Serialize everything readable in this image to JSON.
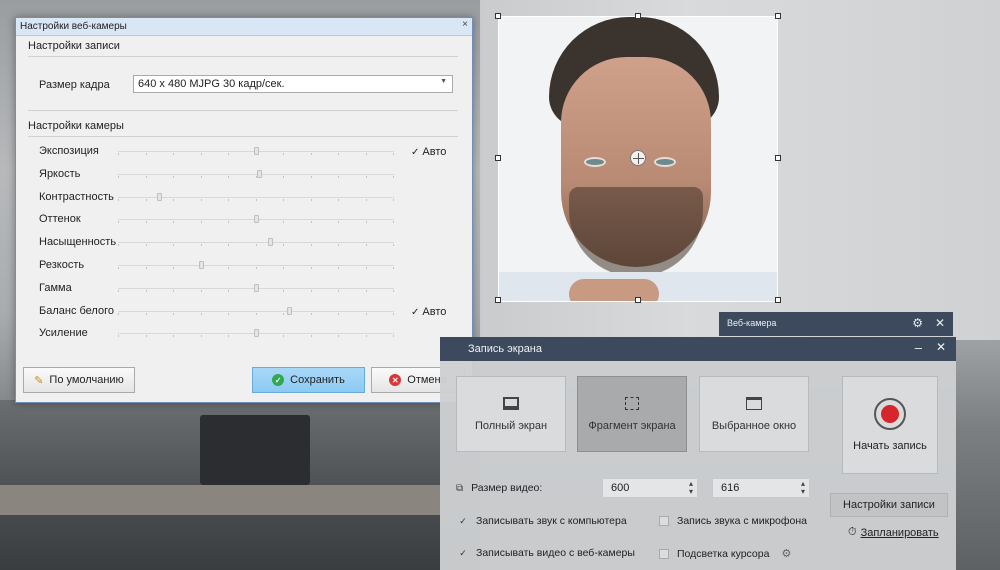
{
  "settings_dialog": {
    "title": "Настройки веб-камеры",
    "close_glyph": "×",
    "record_section": "Настройки записи",
    "frame_size_label": "Размер кадра",
    "frame_size_value": "640 x 480 MJPG 30 кадр/сек.",
    "camera_section": "Настройки камеры",
    "sliders": [
      {
        "label": "Экспозиция",
        "value": 0.5,
        "auto": true
      },
      {
        "label": "Яркость",
        "value": 0.51
      },
      {
        "label": "Контрастность",
        "value": 0.15
      },
      {
        "label": "Оттенок",
        "value": 0.5
      },
      {
        "label": "Насыщенность",
        "value": 0.55
      },
      {
        "label": "Резкость",
        "value": 0.3
      },
      {
        "label": "Гамма",
        "value": 0.5
      },
      {
        "label": "Баланс белого",
        "value": 0.62,
        "auto": true
      },
      {
        "label": "Усиление",
        "value": 0.5
      }
    ],
    "auto_label": "Авто",
    "default_button": "По умолчанию",
    "save_button": "Сохранить",
    "cancel_button": "Отмена"
  },
  "webcam_bar": {
    "title": "Веб-камера",
    "gear_glyph": "⚙",
    "close_glyph": "✕"
  },
  "screen_recording": {
    "title": "Запись экрана",
    "minimize_glyph": "–",
    "close_glyph": "✕",
    "modes": [
      "Полный экран",
      "Фрагмент экрана",
      "Выбранное окно"
    ],
    "active_mode": "Фрагмент экрана",
    "start_button": "Начать запись",
    "video_size_label": "Размер видео:",
    "width_value": "600",
    "height_value": "616",
    "settings_button": "Настройки записи",
    "schedule_link": "Запланировать",
    "checkboxes": [
      {
        "label": "Записывать звук с компьютера",
        "checked": true
      },
      {
        "label": "Запись звука с микрофона",
        "checked": false
      },
      {
        "label": "Записывать видео с веб-камеры",
        "checked": true
      },
      {
        "label": "Подсветка курсора",
        "checked": false
      }
    ]
  },
  "colors": {
    "accent_blue": "#8ccaf2",
    "record_red": "#d6252b",
    "header_dark": "#3d4a5e"
  }
}
